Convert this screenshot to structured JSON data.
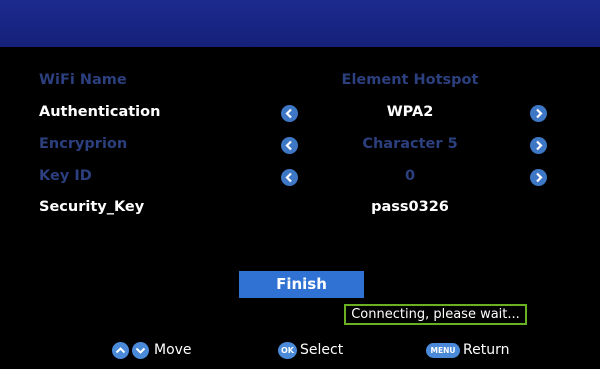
{
  "settings": {
    "rows": [
      {
        "label": "WiFi Name",
        "value": "Element Hotspot",
        "enabled": false,
        "has_arrows": false
      },
      {
        "label": "Authentication",
        "value": "WPA2",
        "enabled": true,
        "has_arrows": true
      },
      {
        "label": "Encryprion",
        "value": "Character 5",
        "enabled": false,
        "has_arrows": true
      },
      {
        "label": "Key ID",
        "value": "0",
        "enabled": false,
        "has_arrows": true
      },
      {
        "label": "Security_Key",
        "value": "pass0326",
        "enabled": true,
        "has_arrows": false
      }
    ]
  },
  "actions": {
    "finish_label": "Finish"
  },
  "status": {
    "text": "Connecting, please wait..."
  },
  "hints": {
    "move_label": "Move",
    "select_label": "Select",
    "ok_badge": "OK",
    "return_label": "Return",
    "menu_badge": "MENU"
  },
  "icons": {
    "arrow_left": "chevron-left-icon",
    "arrow_right": "chevron-right-icon",
    "up": "chevron-up-icon",
    "down": "chevron-down-icon"
  },
  "colors": {
    "background": "#000000",
    "header_bar": "#1d2a8e",
    "enabled_text": "#ffffff",
    "disabled_text": "#2c3f7e",
    "accent_button": "#2f72d4",
    "focus_border": "#6ab023",
    "arrow_button": "#3d77c5"
  }
}
